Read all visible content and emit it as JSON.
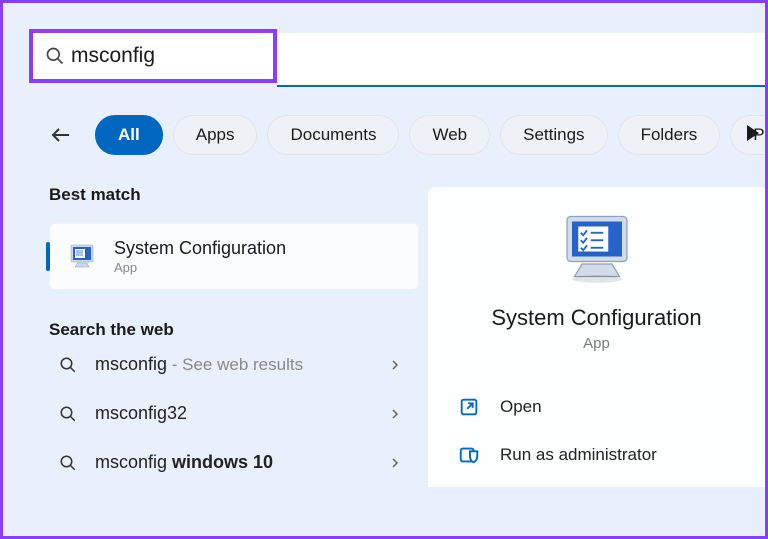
{
  "search": {
    "value": "msconfig"
  },
  "filters": {
    "items": [
      "All",
      "Apps",
      "Documents",
      "Web",
      "Settings",
      "Folders",
      "Pho"
    ],
    "active_index": 0
  },
  "sections": {
    "best_match": "Best match",
    "search_web": "Search the web"
  },
  "best": {
    "title": "System Configuration",
    "subtitle": "App"
  },
  "web_results": [
    {
      "term": "msconfig",
      "detail": " - See web results"
    },
    {
      "term": "msconfig32",
      "detail": ""
    },
    {
      "term_prefix": "msconfig ",
      "term_bold": "windows 10",
      "detail": ""
    }
  ],
  "preview": {
    "title": "System Configuration",
    "subtitle": "App",
    "actions": [
      {
        "icon": "open-icon",
        "label": "Open"
      },
      {
        "icon": "shield-icon",
        "label": "Run as administrator"
      }
    ]
  }
}
